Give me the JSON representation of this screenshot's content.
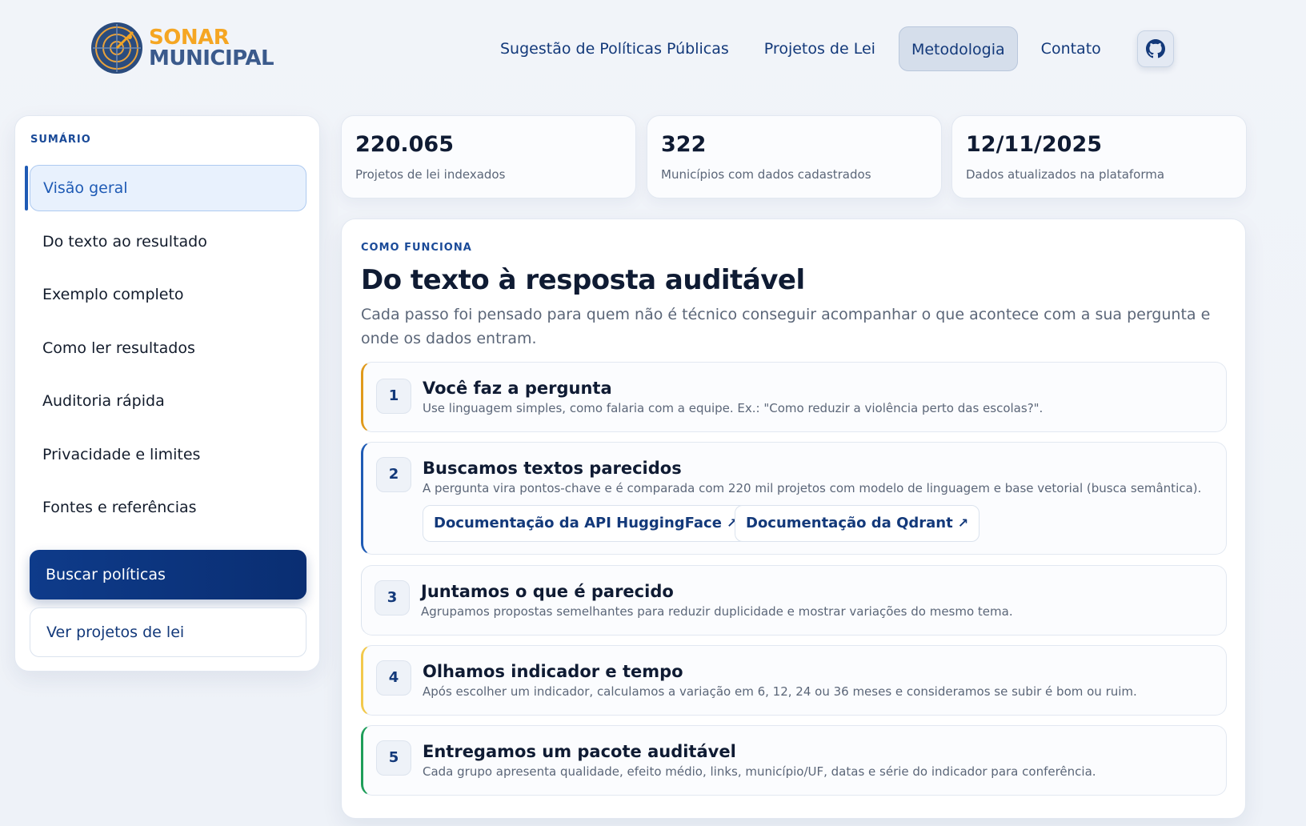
{
  "brand": {
    "line1": "SONAR",
    "line2": "MUNICIPAL"
  },
  "nav": {
    "items": [
      "Sugestão de Políticas Públicas",
      "Projetos de Lei",
      "Metodologia",
      "Contato"
    ],
    "active": "Metodologia",
    "github_icon": "github-icon"
  },
  "sidebar": {
    "heading": "SUMÁRIO",
    "items": [
      "Visão geral",
      "Do texto ao resultado",
      "Exemplo completo",
      "Como ler resultados",
      "Auditoria rápida",
      "Privacidade e limites",
      "Fontes e referências"
    ],
    "active": "Visão geral",
    "primary_button": "Buscar políticas",
    "secondary_button": "Ver projetos de lei"
  },
  "stats": [
    {
      "value": "220.065",
      "label": "Projetos de lei indexados"
    },
    {
      "value": "322",
      "label": "Municípios com dados cadastrados"
    },
    {
      "value": "12/11/2025",
      "label": "Dados atualizados na plataforma"
    }
  ],
  "main": {
    "eyebrow": "COMO FUNCIONA",
    "title": "Do texto à resposta auditável",
    "description": "Cada passo foi pensado para quem não é técnico conseguir acompanhar o que acontece com a sua pergunta e onde os dados entram.",
    "steps": [
      {
        "number": "1",
        "title": "Você faz a pergunta",
        "desc": "Use linguagem simples, como falaria com a equipe. Ex.: \"Como reduzir a violência perto das escolas?\".",
        "accent": "#e09a1c"
      },
      {
        "number": "2",
        "title": "Buscamos textos parecidos",
        "desc": "A pergunta vira pontos-chave e é comparada com 220 mil projetos com modelo de linguagem e base vetorial (busca semântica).",
        "accent": "#1f5bb5",
        "links": [
          "Documentação da API HuggingFace",
          "Documentação da Qdrant"
        ]
      },
      {
        "number": "3",
        "title": "Juntamos o que é parecido",
        "desc": "Agrupamos propostas semelhantes para reduzir duplicidade e mostrar variações do mesmo tema.",
        "accent": "#dbe3ee"
      },
      {
        "number": "4",
        "title": "Olhamos indicador e tempo",
        "desc": "Após escolher um indicador, calculamos a variação em 6, 12, 24 ou 36 meses e consideramos se subir é bom ou ruim.",
        "accent": "#f2c94c"
      },
      {
        "number": "5",
        "title": "Entregamos um pacote auditável",
        "desc": "Cada grupo apresenta qualidade, efeito médio, links, município/UF, datas e série do indicador para conferência.",
        "accent": "#1e9e5a"
      }
    ]
  }
}
